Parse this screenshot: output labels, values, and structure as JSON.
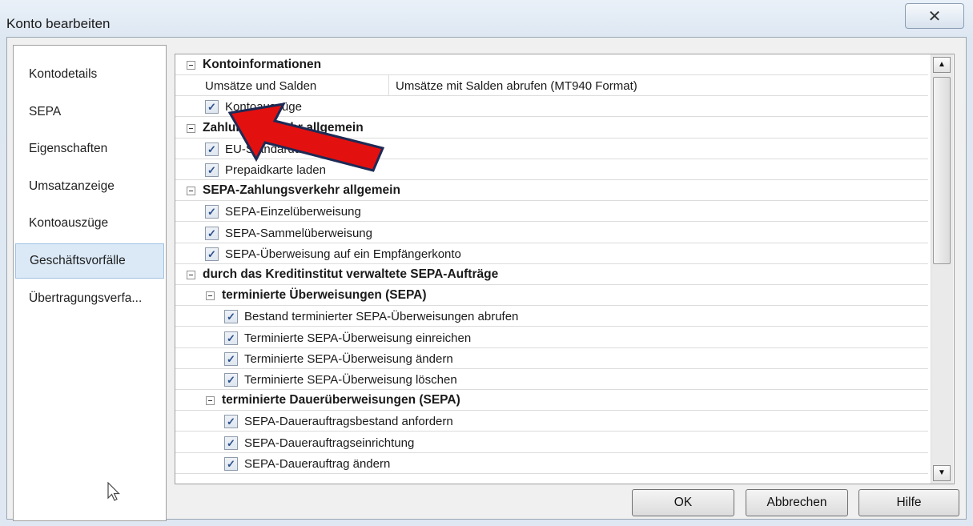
{
  "window": {
    "title": "Konto bearbeiten",
    "close_icon": "close-x-icon"
  },
  "sidebar": {
    "items": [
      {
        "label": "Kontodetails"
      },
      {
        "label": "SEPA"
      },
      {
        "label": "Eigenschaften"
      },
      {
        "label": "Umsatzanzeige"
      },
      {
        "label": "Kontoauszüge"
      },
      {
        "label": "Geschäftsvorfälle",
        "selected": true
      },
      {
        "label": "Übertragungsverfa..."
      }
    ]
  },
  "tree": {
    "rows": [
      {
        "type": "group",
        "label": "Kontoinformationen",
        "level": 0
      },
      {
        "type": "kv",
        "key": "Umsätze und Salden",
        "value": "Umsätze mit Salden abrufen (MT940 Format)",
        "level": 1
      },
      {
        "type": "check",
        "label": "Kontoauszüge",
        "checked": true,
        "level": 1
      },
      {
        "type": "group",
        "label": "Zahlungsverkehr allgemein",
        "level": 0
      },
      {
        "type": "check",
        "label": "EU-Standardüberweisung",
        "checked": true,
        "level": 1
      },
      {
        "type": "check",
        "label": "Prepaidkarte laden",
        "checked": true,
        "level": 1
      },
      {
        "type": "group",
        "label": "SEPA-Zahlungsverkehr allgemein",
        "level": 0
      },
      {
        "type": "check",
        "label": "SEPA-Einzelüberweisung",
        "checked": true,
        "level": 1
      },
      {
        "type": "check",
        "label": "SEPA-Sammelüberweisung",
        "checked": true,
        "level": 1
      },
      {
        "type": "check",
        "label": "SEPA-Überweisung auf ein Empfängerkonto",
        "checked": true,
        "level": 1
      },
      {
        "type": "group",
        "label": "durch das Kreditinstitut verwaltete SEPA-Aufträge",
        "level": 0
      },
      {
        "type": "group",
        "label": "terminierte Überweisungen (SEPA)",
        "level": 1
      },
      {
        "type": "check",
        "label": "Bestand terminierter SEPA-Überweisungen abrufen",
        "checked": true,
        "level": 2
      },
      {
        "type": "check",
        "label": "Terminierte SEPA-Überweisung einreichen",
        "checked": true,
        "level": 2
      },
      {
        "type": "check",
        "label": "Terminierte SEPA-Überweisung ändern",
        "checked": true,
        "level": 2
      },
      {
        "type": "check",
        "label": "Terminierte SEPA-Überweisung löschen",
        "checked": true,
        "level": 2
      },
      {
        "type": "group",
        "label": "terminierte Dauerüberweisungen (SEPA)",
        "level": 1
      },
      {
        "type": "check",
        "label": "SEPA-Dauerauftragsbestand anfordern",
        "checked": true,
        "level": 2
      },
      {
        "type": "check",
        "label": "SEPA-Dauerauftragseinrichtung",
        "checked": true,
        "level": 2
      },
      {
        "type": "check",
        "label": "SEPA-Dauerauftrag ändern",
        "checked": true,
        "level": 2
      }
    ],
    "check_glyph": "✓",
    "scroll_up": "▲",
    "scroll_down": "▼",
    "scroll_position": 0.0
  },
  "buttons": {
    "ok": "OK",
    "cancel": "Abbrechen",
    "help": "Hilfe"
  },
  "annotation": {
    "arrow_color": "#e31010",
    "arrow_outline": "#1d2a55",
    "points_to": "Kontoauszüge"
  }
}
